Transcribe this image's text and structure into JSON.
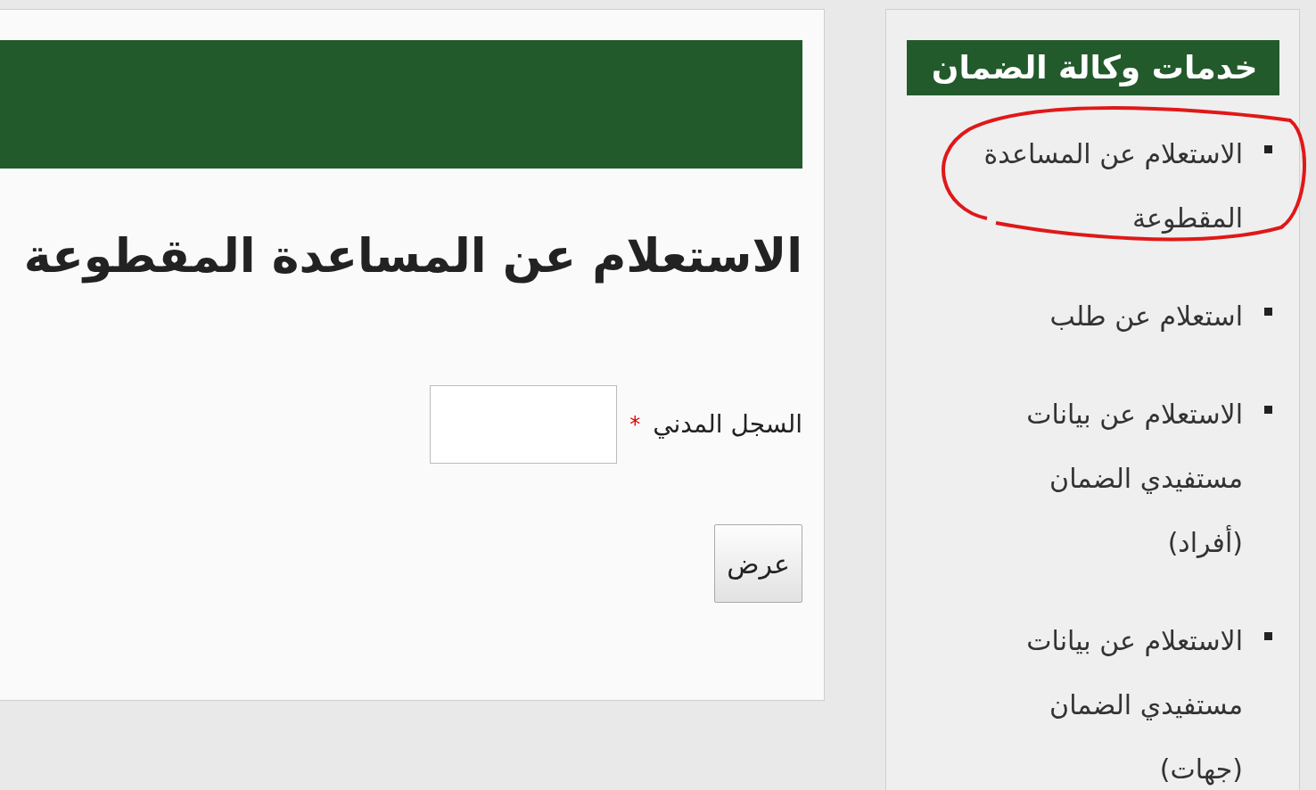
{
  "main": {
    "title": "الاستعلام عن المساعدة المقطوعة",
    "field": {
      "label": "السجل المدني",
      "required": true,
      "required_mark": "*"
    },
    "button": "عرض"
  },
  "sidebar": {
    "title": "خدمات وكالة الضمان",
    "items": [
      {
        "label": "الاستعلام عن المساعدة المقطوعة",
        "highlighted": true
      },
      {
        "label": "استعلام عن طلب",
        "highlighted": false
      },
      {
        "label": "الاستعلام عن بيانات مستفيدي الضمان (أفراد)",
        "highlighted": false
      },
      {
        "label": "الاستعلام عن بيانات مستفيدي الضمان (جهات)",
        "highlighted": false
      }
    ]
  }
}
